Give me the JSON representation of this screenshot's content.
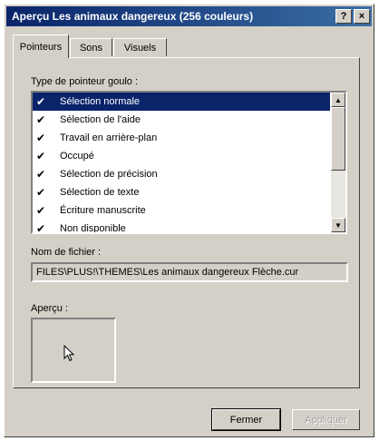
{
  "window": {
    "title": "Aperçu Les animaux dangereux (256 couleurs)",
    "help_label": "?",
    "close_label": "×"
  },
  "tabs": [
    {
      "label": "Pointeurs",
      "active": true
    },
    {
      "label": "Sons",
      "active": false
    },
    {
      "label": "Visuels",
      "active": false
    }
  ],
  "pointer_section": {
    "label": "Type de pointeur goulo :",
    "items": [
      {
        "label": "Sélection normale",
        "selected": true
      },
      {
        "label": "Sélection de l'aide",
        "selected": false
      },
      {
        "label": "Travail en arrière-plan",
        "selected": false
      },
      {
        "label": "Occupé",
        "selected": false
      },
      {
        "label": "Sélection de précision",
        "selected": false
      },
      {
        "label": "Sélection de texte",
        "selected": false
      },
      {
        "label": "Écriture manuscrite",
        "selected": false
      },
      {
        "label": "Non disponible",
        "selected": false
      }
    ]
  },
  "file": {
    "label": "Nom de fichier :",
    "value": "FILES\\PLUS!\\THEMES\\Les animaux dangereux Flèche.cur"
  },
  "preview": {
    "label": "Aperçu :"
  },
  "buttons": {
    "close_label": "Fermer",
    "apply_label": "Appliquer"
  }
}
